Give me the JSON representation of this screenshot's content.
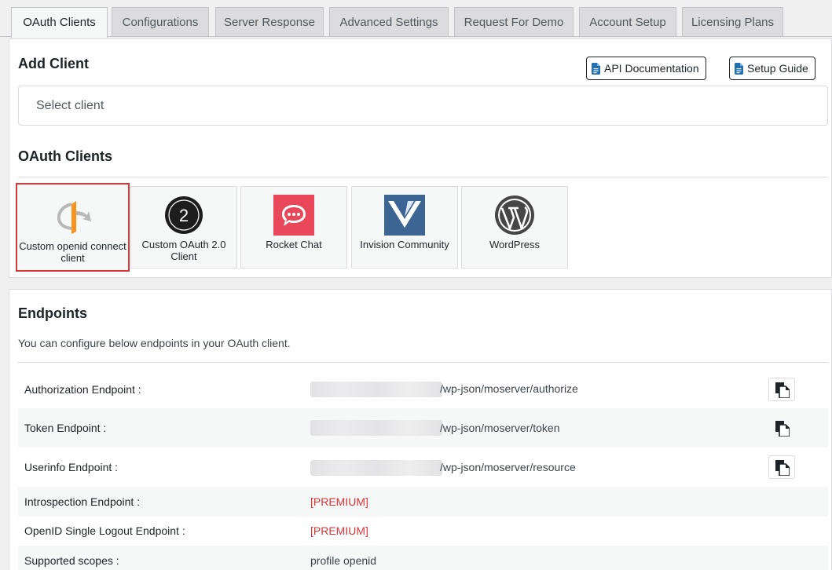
{
  "tabs": [
    {
      "label": "OAuth Clients",
      "active": true
    },
    {
      "label": "Configurations"
    },
    {
      "label": "Server Response"
    },
    {
      "label": "Advanced Settings"
    },
    {
      "label": "Request For Demo"
    },
    {
      "label": "Account Setup"
    },
    {
      "label": "Licensing Plans"
    }
  ],
  "add_client": {
    "title": "Add Client",
    "api_doc_label": "API Documentation",
    "setup_guide_label": "Setup Guide",
    "select_placeholder": "Select client"
  },
  "oauth_clients": {
    "title": "OAuth Clients",
    "cards": [
      {
        "label": "Custom openid connect client",
        "icon": "openid-icon",
        "selected": true
      },
      {
        "label": "Custom OAuth 2.0 Client",
        "icon": "oauth2-icon"
      },
      {
        "label": "Rocket Chat",
        "icon": "rocket-chat-icon"
      },
      {
        "label": "Invision Community",
        "icon": "invision-icon"
      },
      {
        "label": "WordPress",
        "icon": "wordpress-icon"
      }
    ]
  },
  "endpoints": {
    "title": "Endpoints",
    "description": "You can configure below endpoints in your OAuth client.",
    "rows": [
      {
        "label": "Authorization Endpoint :",
        "value": "/wp-json/moserver/authorize"
      },
      {
        "label": "Token Endpoint :",
        "value": "/wp-json/moserver/token"
      },
      {
        "label": "Userinfo Endpoint :",
        "value": "/wp-json/moserver/resource"
      },
      {
        "label": "Introspection Endpoint :",
        "value": "[PREMIUM]"
      },
      {
        "label": "OpenID Single Logout Endpoint :",
        "value": "[PREMIUM]"
      },
      {
        "label": "Supported scopes :",
        "value": "profile openid"
      }
    ]
  },
  "colors": {
    "accent": "#2271b1",
    "premium": "#d63638",
    "selected_border": "#d63638"
  }
}
